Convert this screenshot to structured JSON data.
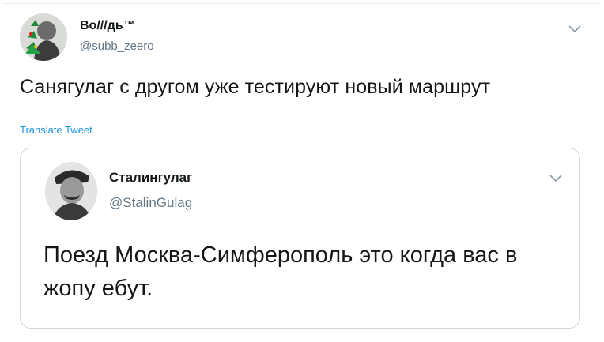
{
  "tweet": {
    "author_name": "Во///дь™",
    "author_handle": "@subb_zeero",
    "text": "Санягулаг с другом уже тестируют новый маршрут",
    "translate_label": "Translate Tweet",
    "menu_icon": "chevron-down-icon"
  },
  "quoted_tweet": {
    "author_name": "Сталингулаг",
    "author_handle": "@StalinGulag",
    "text": "Поезд Москва-Симферополь это когда вас в жопу ебут.",
    "menu_icon": "chevron-down-icon"
  },
  "colors": {
    "text": "#14171a",
    "secondary": "#657786",
    "link": "#1b95e0",
    "border": "#ccd6dd"
  }
}
